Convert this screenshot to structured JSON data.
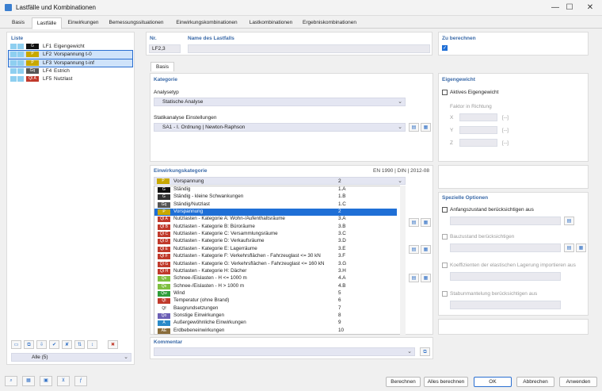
{
  "window": {
    "title": "Lastfälle und Kombinationen",
    "min": "—",
    "max": "☐",
    "close": "✕"
  },
  "tabs": [
    "Basis",
    "Lastfälle",
    "Einwirkungen",
    "Bemessungssituationen",
    "Einwirkungskombinationen",
    "Lastkombinationen",
    "Ergebniskombinationen"
  ],
  "list": {
    "header": "Liste",
    "items": [
      {
        "code": "G",
        "color": "#111111",
        "id": "LF1",
        "name": "Eigengewicht"
      },
      {
        "code": "P",
        "color": "#c8a800",
        "id": "LF2",
        "name": "Vorspannung t-0"
      },
      {
        "code": "P",
        "color": "#c8a800",
        "id": "LF3",
        "name": "Vorspannung t-inf"
      },
      {
        "code": "Gq",
        "color": "#555555",
        "id": "LF4",
        "name": "Estrich"
      },
      {
        "code": "QI A",
        "color": "#c0392b",
        "id": "LF5",
        "name": "Nutzlast"
      }
    ],
    "filter": "Alle (5)"
  },
  "header": {
    "nr_label": "Nr.",
    "nr_value": "LF2,3",
    "name_label": "Name des Lastfalls",
    "calc_label": "Zu berechnen"
  },
  "subtab": "Basis",
  "kategorie": {
    "header": "Kategorie",
    "analysetyp_label": "Analysetyp",
    "analysetyp_value": "Statische Analyse",
    "statik_label": "Statikanalyse Einstellungen",
    "statik_value": "SA1 - I. Ordnung | Newton-Raphson"
  },
  "eigengewicht": {
    "header": "Eigengewicht",
    "checkbox": "Aktives Eigengewicht",
    "faktor": "Faktor in Richtung",
    "axes": [
      "X",
      "Y",
      "Z"
    ],
    "unit": "[--]"
  },
  "einwirkung": {
    "header": "Einwirkungskategorie",
    "norm": "EN 1990 | DIN | 2012-08",
    "selected_name": "Vorspannung",
    "selected_code": "2",
    "items": [
      {
        "code": "G",
        "color": "#111111",
        "name": "Ständig",
        "num": "1.A"
      },
      {
        "code": "G",
        "color": "#333333",
        "name": "Ständig - kleine Schwankungen",
        "num": "1.B"
      },
      {
        "code": "Gq",
        "color": "#555555",
        "name": "Ständig/Nutzlast",
        "num": "1.C"
      },
      {
        "code": "P",
        "color": "#c8a800",
        "name": "Vorspannung",
        "num": "2"
      },
      {
        "code": "QI A",
        "color": "#c0392b",
        "name": "Nutzlasten - Kategorie A: Wohn-/Aufenthaltsräume",
        "num": "3.A"
      },
      {
        "code": "QI B",
        "color": "#c0392b",
        "name": "Nutzlasten - Kategorie B: Büroräume",
        "num": "3.B"
      },
      {
        "code": "QI C",
        "color": "#c0392b",
        "name": "Nutzlasten - Kategorie C: Versammlungsräume",
        "num": "3.C"
      },
      {
        "code": "QI D",
        "color": "#c0392b",
        "name": "Nutzlasten - Kategorie D: Verkaufsräume",
        "num": "3.D"
      },
      {
        "code": "QI E",
        "color": "#c0392b",
        "name": "Nutzlasten - Kategorie E: Lagerräume",
        "num": "3.E"
      },
      {
        "code": "QI F",
        "color": "#c0392b",
        "name": "Nutzlasten - Kategorie F: Verkehrsflächen - Fahrzeuglast <= 30 kN",
        "num": "3.F"
      },
      {
        "code": "QI G",
        "color": "#c0392b",
        "name": "Nutzlasten - Kategorie G: Verkehrsflächen - Fahrzeuglast <= 160 kN",
        "num": "3.G"
      },
      {
        "code": "QI H",
        "color": "#c0392b",
        "name": "Nutzlasten - Kategorie H: Dächer",
        "num": "3.H"
      },
      {
        "code": "Qs",
        "color": "#7fbf3f",
        "name": "Schnee-/Eislasten - H <= 1000 m",
        "num": "4.A"
      },
      {
        "code": "Qs",
        "color": "#7fbf3f",
        "name": "Schnee-/Eislasten - H > 1000 m",
        "num": "4.B"
      },
      {
        "code": "Qw",
        "color": "#2e9d3a",
        "name": "Wind",
        "num": "5"
      },
      {
        "code": "Qt",
        "color": "#c0392b",
        "name": "Temperatur (ohne Brand)",
        "num": "6"
      },
      {
        "code": "Qf",
        "color": "#ffffff",
        "name": "Baugrundsetzungen",
        "num": "7"
      },
      {
        "code": "Qo",
        "color": "#6b5fb5",
        "name": "Sonstige Einwirkungen",
        "num": "8"
      },
      {
        "code": "A",
        "color": "#2a8ac8",
        "name": "Außergewöhnliche Einwirkungen",
        "num": "9"
      },
      {
        "code": "AE",
        "color": "#8a6d3b",
        "name": "Erdbebeneinwirkungen",
        "num": "10"
      }
    ],
    "highlight_index": 3
  },
  "speziell": {
    "header": "Spezielle Optionen",
    "opt1": "Anfangszustand berücksichtigen aus",
    "opt2": "Bauzustand berücksichtigen",
    "opt3": "Koeffizienten der elastischen Lagerung importieren aus",
    "opt4": "Stabunmantelung berücksichtigen aus"
  },
  "kommentar": {
    "header": "Kommentar"
  },
  "buttons": {
    "berechnen": "Berechnen",
    "alle": "Alles berechnen",
    "ok": "OK",
    "abbrechen": "Abbrechen",
    "anwenden": "Anwenden"
  }
}
